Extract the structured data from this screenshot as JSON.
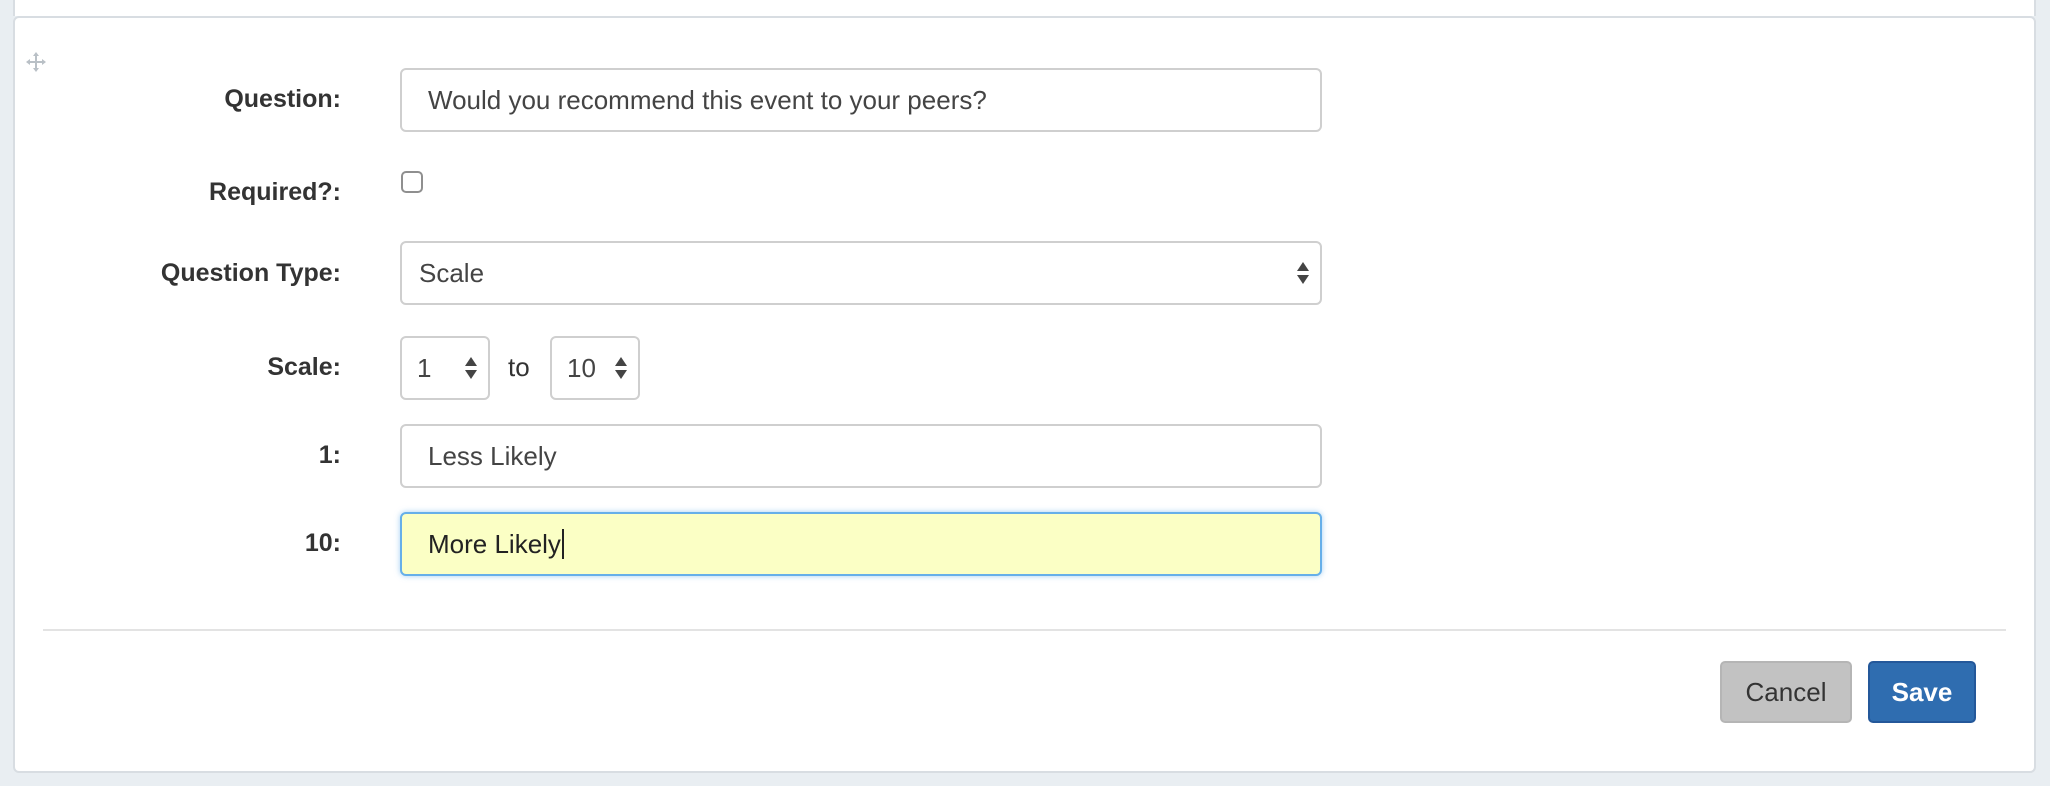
{
  "form": {
    "question_label": "Question:",
    "question_value": "Would you recommend this event to your peers?",
    "required_label": "Required?:",
    "required_checked": false,
    "question_type_label": "Question Type:",
    "question_type_value": "Scale",
    "scale_label": "Scale:",
    "scale_min": "1",
    "scale_to": "to",
    "scale_max": "10",
    "min_label": "1:",
    "min_value": "Less Likely",
    "max_label": "10:",
    "max_value": "More Likely"
  },
  "actions": {
    "cancel_label": "Cancel",
    "save_label": "Save"
  },
  "colors": {
    "save_button": "#2f6db0",
    "cancel_button": "#c2c2c2",
    "focused_input_bg": "#fbffc5",
    "focus_border": "#66afe9"
  },
  "icons": {
    "drag": "move-icon",
    "select_arrows": "select-arrows-icon"
  }
}
